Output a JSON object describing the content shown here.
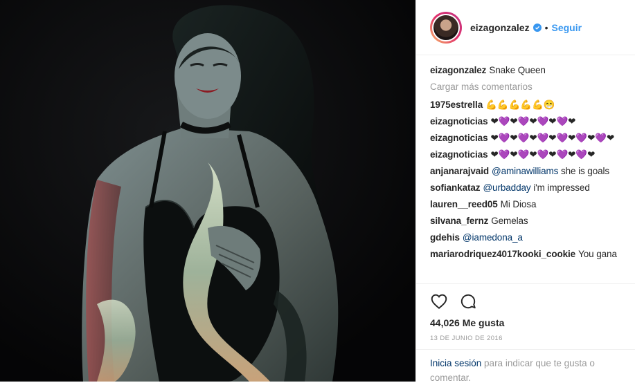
{
  "post": {
    "photo_alt": "",
    "author": "eizagonzalez",
    "follow_label": "Seguir",
    "separator": "•"
  },
  "caption": {
    "user": "eizagonzalez",
    "text": "Snake Queen"
  },
  "load_more": "Cargar más comentarios",
  "comments": [
    {
      "user": "1975estrella",
      "text": "💪💪💪💪💪😁"
    },
    {
      "user": "eizagnoticias",
      "text": "❤💜❤💜❤💜❤💜❤"
    },
    {
      "user": "eizagnoticias",
      "text": "❤💜❤💜❤💜❤💜❤💜❤💜❤"
    },
    {
      "user": "eizagnoticias",
      "text": "❤💜❤💜❤💜❤💜❤💜❤"
    },
    {
      "user": "anjanarajvaid",
      "mention": "@aminawilliams",
      "text": " she is goals"
    },
    {
      "user": "sofiankataz",
      "mention": "@urbadday",
      "text": " i'm impressed"
    },
    {
      "user": "lauren__reed05",
      "text": "Mi Diosa"
    },
    {
      "user": "silvana_fernz",
      "text": "Gemelas"
    },
    {
      "user": "gdehis",
      "mention": "@iamedona_a",
      "text": ""
    },
    {
      "user": "mariarodriquez4017kooki_cookie",
      "text": "You gana"
    }
  ],
  "actions": {
    "like_icon": "heart-outline-icon",
    "comment_icon": "comment-bubble-icon"
  },
  "likes": "44,026 Me gusta",
  "date": "13 DE JUNIO DE 2016",
  "login": {
    "link": "Inicia sesión",
    "text": " para indicar que te gusta o comentar."
  },
  "colors": {
    "accent": "#3897f0",
    "link": "#003569",
    "muted": "#999999",
    "heart_red": "#e0245e",
    "heart_purple": "#8a5cf5"
  }
}
